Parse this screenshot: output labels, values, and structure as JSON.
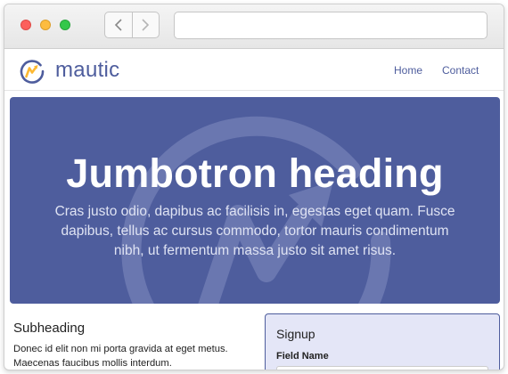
{
  "browser": {
    "back_icon": "chevron-left-icon",
    "forward_icon": "chevron-right-icon",
    "url": ""
  },
  "site": {
    "brand": "mautic",
    "brand_color": "#4e5d9d",
    "nav": [
      {
        "label": "Home"
      },
      {
        "label": "Contact"
      }
    ]
  },
  "jumbotron": {
    "heading": "Jumbotron heading",
    "text": "Cras justo odio, dapibus ac facilisis in, egestas eget quam. Fusce dapibus, tellus ac cursus commodo, tortor mauris condimentum nibh, ut fermentum massa justo sit amet risus.",
    "background": "#4e5d9d"
  },
  "content": {
    "subheading": "Subheading",
    "text": "Donec id elit non mi porta gravida at eget metus. Maecenas faucibus mollis interdum."
  },
  "signup": {
    "title": "Signup",
    "field_label": "Field Name",
    "field_value": "",
    "background": "#e4e6f7"
  }
}
